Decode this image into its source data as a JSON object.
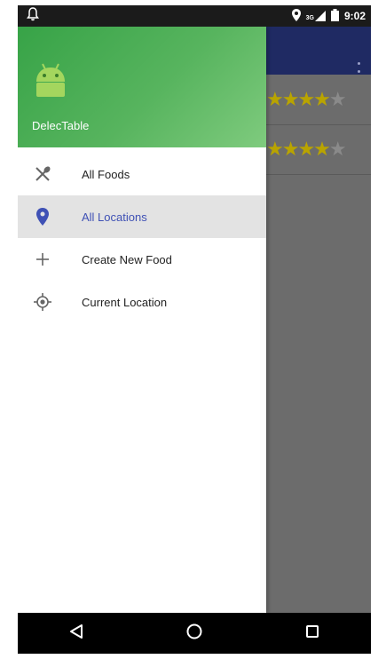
{
  "status_bar": {
    "time": "9:02",
    "network": "3G",
    "icons": [
      "notification-bell-icon",
      "location-icon",
      "signal-icon",
      "battery-icon"
    ]
  },
  "drawer": {
    "app_name": "DelecTable",
    "header_color": "#4caf50",
    "items": [
      {
        "label": "All Foods",
        "icon": "fork-knife-icon",
        "selected": false
      },
      {
        "label": "All Locations",
        "icon": "location-pin-icon",
        "selected": true
      },
      {
        "label": "Create New Food",
        "icon": "plus-icon",
        "selected": false
      },
      {
        "label": "Current Location",
        "icon": "gps-target-icon",
        "selected": false
      }
    ]
  },
  "background": {
    "app_bar_color": "#1f2a63",
    "ratings": [
      {
        "stars": 4,
        "max": 5
      },
      {
        "stars": 4,
        "max": 5
      }
    ]
  },
  "nav_bar": {
    "buttons": [
      "back-icon",
      "home-icon",
      "recents-icon"
    ]
  },
  "colors": {
    "accent": "#3f51b5",
    "star": "#b9a400"
  }
}
